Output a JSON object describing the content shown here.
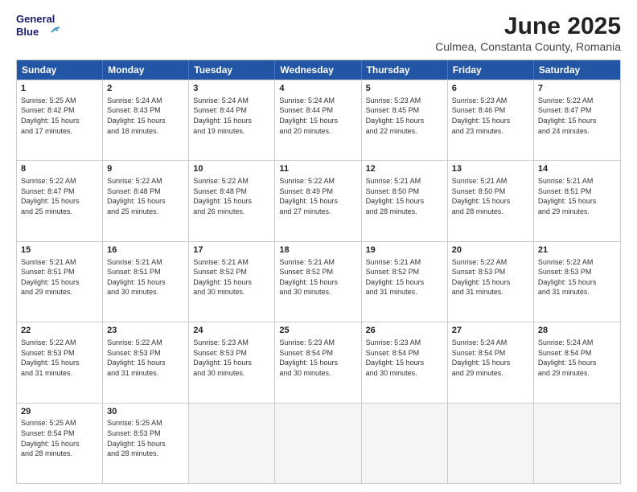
{
  "header": {
    "logo_line1": "General",
    "logo_line2": "Blue",
    "month": "June 2025",
    "location": "Culmea, Constanta County, Romania"
  },
  "weekdays": [
    "Sunday",
    "Monday",
    "Tuesday",
    "Wednesday",
    "Thursday",
    "Friday",
    "Saturday"
  ],
  "rows": [
    [
      {
        "num": "",
        "info": ""
      },
      {
        "num": "2",
        "info": "Sunrise: 5:24 AM\nSunset: 8:43 PM\nDaylight: 15 hours\nand 18 minutes."
      },
      {
        "num": "3",
        "info": "Sunrise: 5:24 AM\nSunset: 8:44 PM\nDaylight: 15 hours\nand 19 minutes."
      },
      {
        "num": "4",
        "info": "Sunrise: 5:24 AM\nSunset: 8:44 PM\nDaylight: 15 hours\nand 20 minutes."
      },
      {
        "num": "5",
        "info": "Sunrise: 5:23 AM\nSunset: 8:45 PM\nDaylight: 15 hours\nand 22 minutes."
      },
      {
        "num": "6",
        "info": "Sunrise: 5:23 AM\nSunset: 8:46 PM\nDaylight: 15 hours\nand 23 minutes."
      },
      {
        "num": "7",
        "info": "Sunrise: 5:22 AM\nSunset: 8:47 PM\nDaylight: 15 hours\nand 24 minutes."
      }
    ],
    [
      {
        "num": "8",
        "info": "Sunrise: 5:22 AM\nSunset: 8:47 PM\nDaylight: 15 hours\nand 25 minutes."
      },
      {
        "num": "9",
        "info": "Sunrise: 5:22 AM\nSunset: 8:48 PM\nDaylight: 15 hours\nand 25 minutes."
      },
      {
        "num": "10",
        "info": "Sunrise: 5:22 AM\nSunset: 8:48 PM\nDaylight: 15 hours\nand 26 minutes."
      },
      {
        "num": "11",
        "info": "Sunrise: 5:22 AM\nSunset: 8:49 PM\nDaylight: 15 hours\nand 27 minutes."
      },
      {
        "num": "12",
        "info": "Sunrise: 5:21 AM\nSunset: 8:50 PM\nDaylight: 15 hours\nand 28 minutes."
      },
      {
        "num": "13",
        "info": "Sunrise: 5:21 AM\nSunset: 8:50 PM\nDaylight: 15 hours\nand 28 minutes."
      },
      {
        "num": "14",
        "info": "Sunrise: 5:21 AM\nSunset: 8:51 PM\nDaylight: 15 hours\nand 29 minutes."
      }
    ],
    [
      {
        "num": "15",
        "info": "Sunrise: 5:21 AM\nSunset: 8:51 PM\nDaylight: 15 hours\nand 29 minutes."
      },
      {
        "num": "16",
        "info": "Sunrise: 5:21 AM\nSunset: 8:51 PM\nDaylight: 15 hours\nand 30 minutes."
      },
      {
        "num": "17",
        "info": "Sunrise: 5:21 AM\nSunset: 8:52 PM\nDaylight: 15 hours\nand 30 minutes."
      },
      {
        "num": "18",
        "info": "Sunrise: 5:21 AM\nSunset: 8:52 PM\nDaylight: 15 hours\nand 30 minutes."
      },
      {
        "num": "19",
        "info": "Sunrise: 5:21 AM\nSunset: 8:52 PM\nDaylight: 15 hours\nand 31 minutes."
      },
      {
        "num": "20",
        "info": "Sunrise: 5:22 AM\nSunset: 8:53 PM\nDaylight: 15 hours\nand 31 minutes."
      },
      {
        "num": "21",
        "info": "Sunrise: 5:22 AM\nSunset: 8:53 PM\nDaylight: 15 hours\nand 31 minutes."
      }
    ],
    [
      {
        "num": "22",
        "info": "Sunrise: 5:22 AM\nSunset: 8:53 PM\nDaylight: 15 hours\nand 31 minutes."
      },
      {
        "num": "23",
        "info": "Sunrise: 5:22 AM\nSunset: 8:53 PM\nDaylight: 15 hours\nand 31 minutes."
      },
      {
        "num": "24",
        "info": "Sunrise: 5:23 AM\nSunset: 8:53 PM\nDaylight: 15 hours\nand 30 minutes."
      },
      {
        "num": "25",
        "info": "Sunrise: 5:23 AM\nSunset: 8:54 PM\nDaylight: 15 hours\nand 30 minutes."
      },
      {
        "num": "26",
        "info": "Sunrise: 5:23 AM\nSunset: 8:54 PM\nDaylight: 15 hours\nand 30 minutes."
      },
      {
        "num": "27",
        "info": "Sunrise: 5:24 AM\nSunset: 8:54 PM\nDaylight: 15 hours\nand 29 minutes."
      },
      {
        "num": "28",
        "info": "Sunrise: 5:24 AM\nSunset: 8:54 PM\nDaylight: 15 hours\nand 29 minutes."
      }
    ],
    [
      {
        "num": "29",
        "info": "Sunrise: 5:25 AM\nSunset: 8:54 PM\nDaylight: 15 hours\nand 28 minutes."
      },
      {
        "num": "30",
        "info": "Sunrise: 5:25 AM\nSunset: 8:53 PM\nDaylight: 15 hours\nand 28 minutes."
      },
      {
        "num": "",
        "info": ""
      },
      {
        "num": "",
        "info": ""
      },
      {
        "num": "",
        "info": ""
      },
      {
        "num": "",
        "info": ""
      },
      {
        "num": "",
        "info": ""
      }
    ]
  ],
  "row0_day1": {
    "num": "1",
    "info": "Sunrise: 5:25 AM\nSunset: 8:42 PM\nDaylight: 15 hours\nand 17 minutes."
  }
}
